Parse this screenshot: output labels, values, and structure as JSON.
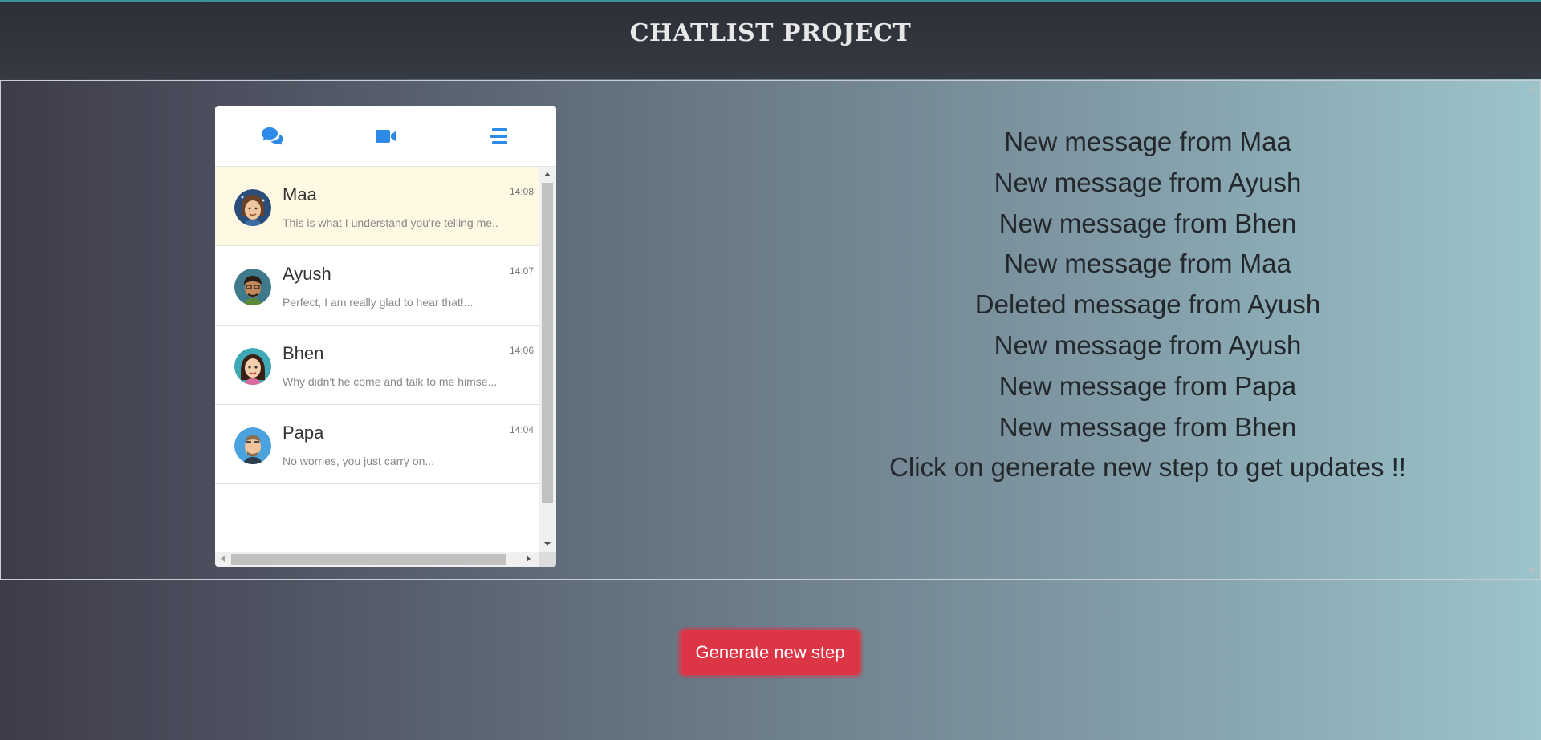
{
  "header": {
    "title": "CHATLIST PROJECT"
  },
  "tabs": [
    {
      "icon": "chat-bubbles-icon"
    },
    {
      "icon": "video-camera-icon"
    },
    {
      "icon": "menu-lines-icon"
    }
  ],
  "chats": [
    {
      "name": "Maa",
      "preview": "This is what I understand you're telling me..",
      "time": "14:08",
      "active": true
    },
    {
      "name": "Ayush",
      "preview": "Perfect, I am really glad to hear that!...",
      "time": "14:07"
    },
    {
      "name": "Bhen",
      "preview": "Why didn't he come and talk to me himse...",
      "time": "14:06"
    },
    {
      "name": "Papa",
      "preview": "No worries, you just carry on...",
      "time": "14:04"
    }
  ],
  "notifications": [
    "New message from Maa",
    "New message from Ayush",
    "New message from Bhen",
    "New message from Maa",
    "Deleted message from Ayush",
    "New message from Ayush",
    "New message from Papa",
    "New message from Bhen",
    "Click on generate new step to get updates !!"
  ],
  "actions": {
    "generate_label": "Generate new step"
  },
  "colors": {
    "accent": "#2d8ae6",
    "button": "#dc3545",
    "active_row": "#fff8e3"
  }
}
